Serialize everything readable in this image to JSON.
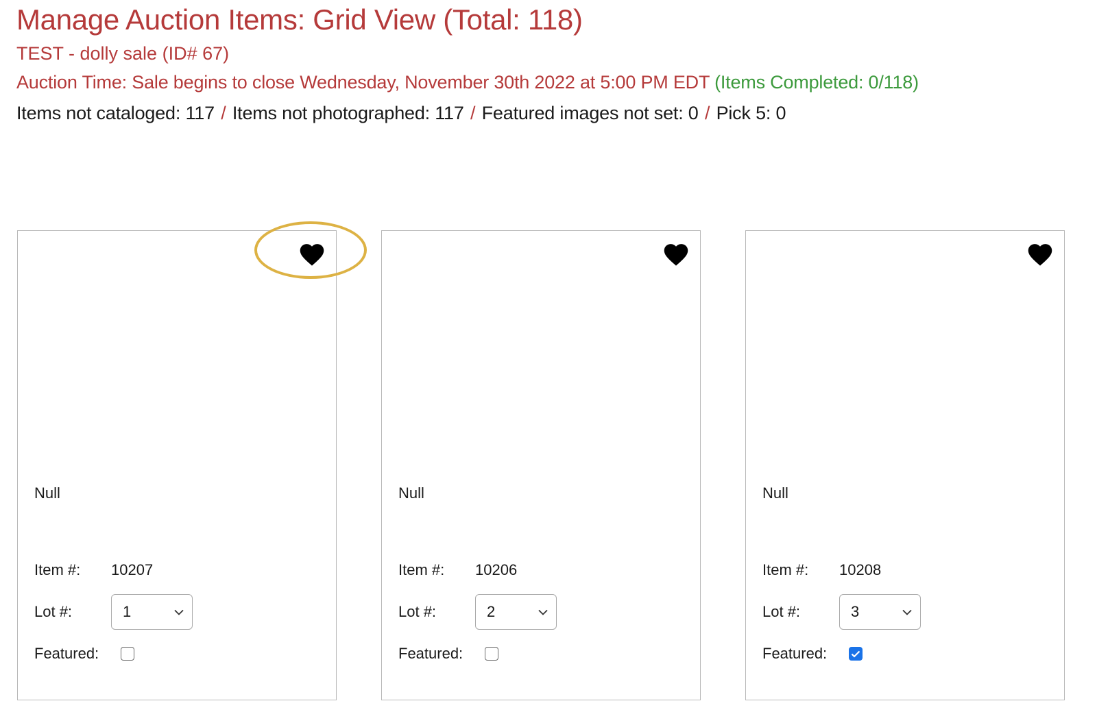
{
  "header": {
    "title": "Manage Auction Items: Grid View  (Total: 118)",
    "sale_name": "TEST - dolly sale (ID# 67)",
    "auction_time": "Auction Time: Sale begins to close Wednesday, November 30th 2022 at 5:00 PM EDT",
    "items_completed": " (Items Completed: 0/118)",
    "stats": {
      "not_cataloged": "Items not cataloged: 117",
      "not_photographed": "Items not photographed: 117",
      "featured_not_set": "Featured images not set: 0",
      "pick5": "Pick 5: 0",
      "separator": "/"
    }
  },
  "labels": {
    "item": "Item #:",
    "lot": "Lot #:",
    "featured": "Featured:"
  },
  "cards": [
    {
      "title": "Null",
      "item_number": "10207",
      "lot": "1",
      "featured": false,
      "favorite_icon": "heart-icon"
    },
    {
      "title": "Null",
      "item_number": "10206",
      "lot": "2",
      "featured": false,
      "favorite_icon": "heart-icon"
    },
    {
      "title": "Null",
      "item_number": "10208",
      "lot": "3",
      "featured": true,
      "favorite_icon": "heart-icon"
    }
  ],
  "colors": {
    "accent_red": "#b53a3a",
    "completed_green": "#3c9a3c",
    "highlight_ring": "#ddb244",
    "checkbox_checked": "#1a73e8"
  }
}
